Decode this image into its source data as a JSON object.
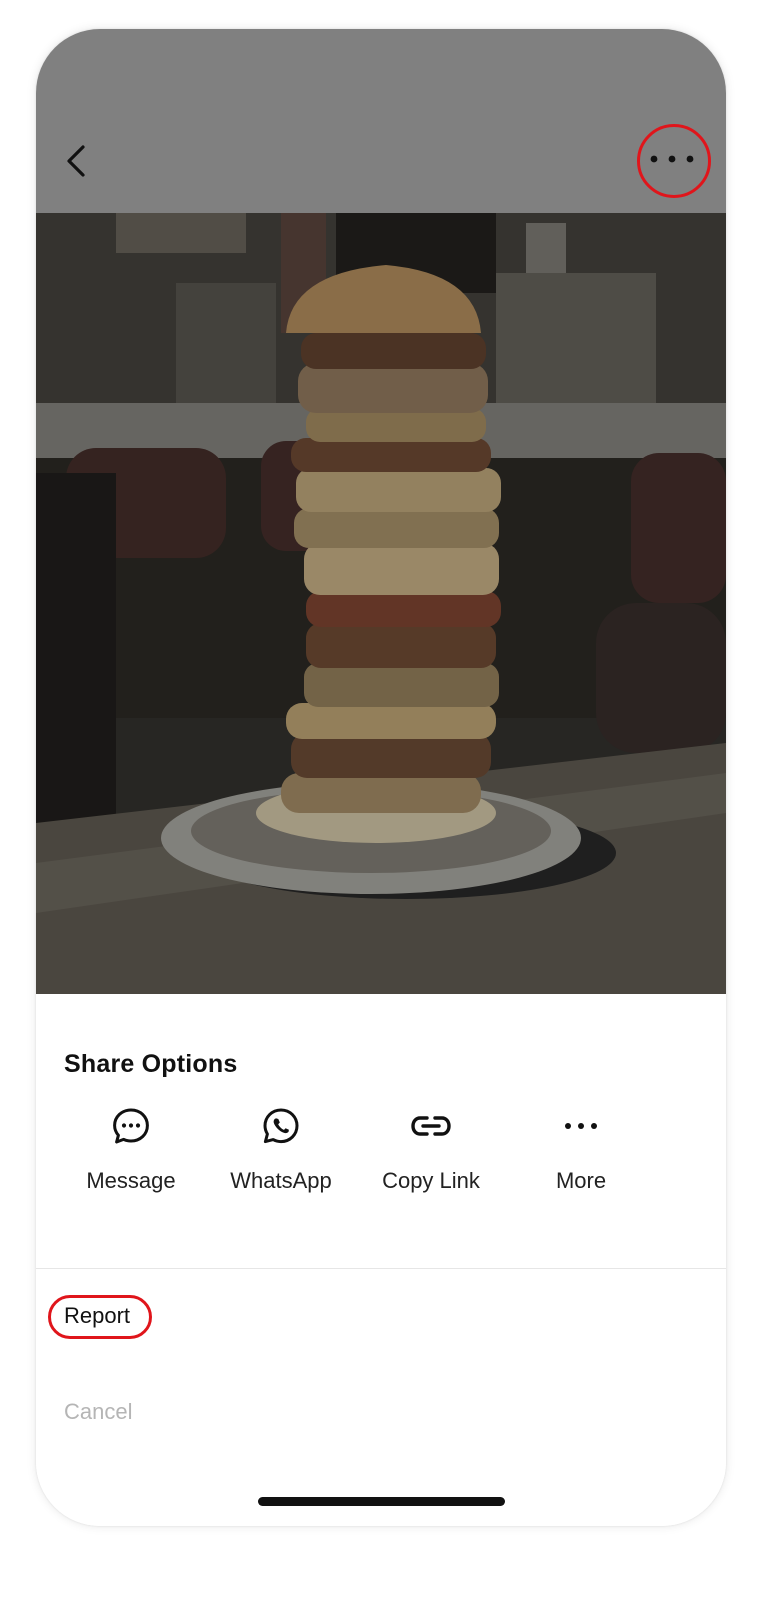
{
  "header": {
    "back_icon": "chevron-left-icon",
    "more_icon": "ellipsis-horizontal-icon"
  },
  "photo": {
    "subject": "Tall stacked burger tower on a plate in a diner"
  },
  "share_sheet": {
    "title": "Share Options",
    "options": [
      {
        "label": "Message",
        "icon": "message-bubble-icon"
      },
      {
        "label": "WhatsApp",
        "icon": "whatsapp-icon"
      },
      {
        "label": "Copy Link",
        "icon": "link-icon"
      },
      {
        "label": "More",
        "icon": "ellipsis-horizontal-icon"
      }
    ],
    "report_label": "Report",
    "cancel_label": "Cancel"
  },
  "colors": {
    "highlight": "#e0151b",
    "overlay": "#808080",
    "cancel_text": "#b5b5b5"
  }
}
